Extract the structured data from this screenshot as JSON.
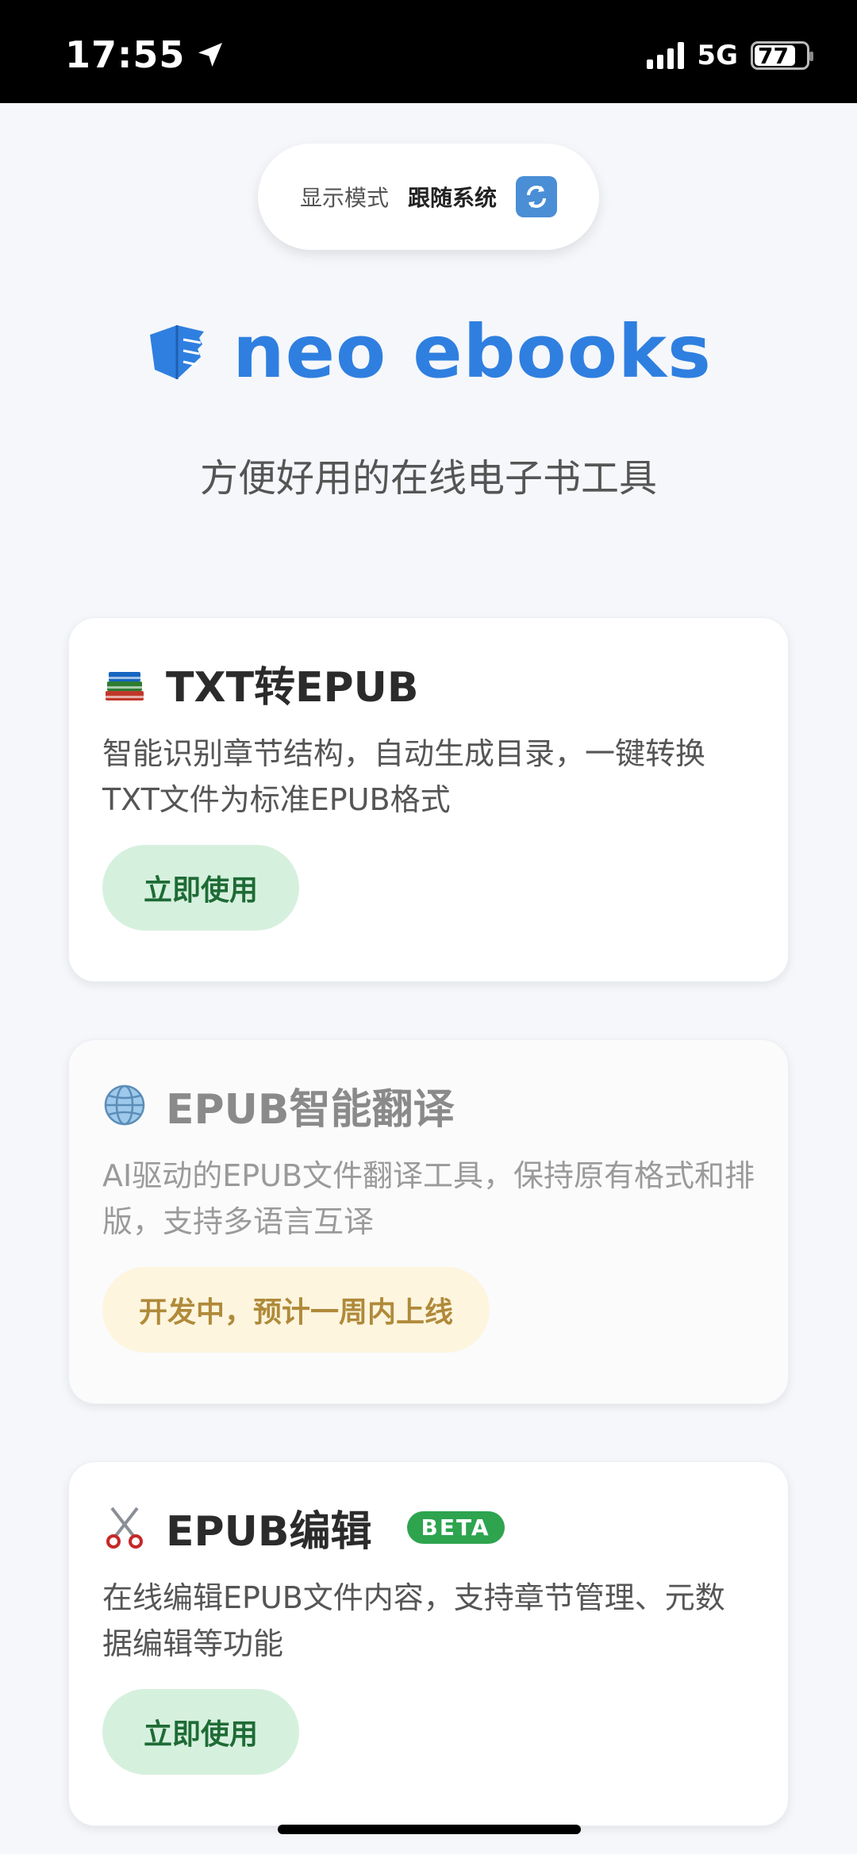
{
  "status_bar": {
    "time": "17:55",
    "network": "5G",
    "battery": "77"
  },
  "display_mode": {
    "label": "显示模式",
    "value": "跟随系统"
  },
  "brand": {
    "name": "neo ebooks",
    "tagline": "方便好用的在线电子书工具",
    "color": "#2f7fe0"
  },
  "cards": [
    {
      "icon": "books-icon",
      "title": "TXT转EPUB",
      "description": "智能识别章节结构，自动生成目录，一键转换TXT文件为标准EPUB格式",
      "button": "立即使用"
    },
    {
      "icon": "globe-icon",
      "title": "EPUB智能翻译",
      "description": "AI驱动的EPUB文件翻译工具，保持原有格式和排版，支持多语言互译",
      "button": "开发中，预计一周内上线"
    },
    {
      "icon": "scissors-icon",
      "title": "EPUB编辑",
      "badge": "BETA",
      "description": "在线编辑EPUB文件内容，支持章节管理、元数据编辑等功能",
      "button": "立即使用"
    }
  ]
}
